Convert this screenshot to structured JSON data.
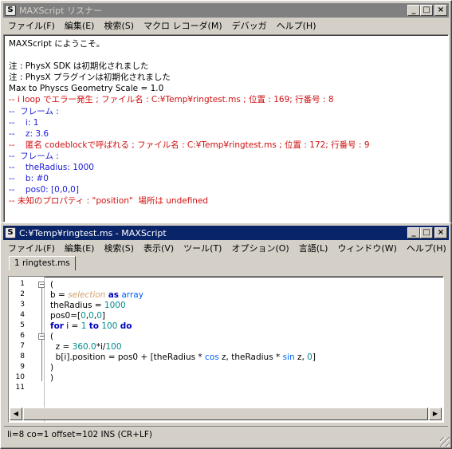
{
  "listener": {
    "title": "MAXScript リスナー",
    "icon": "maxscript-s-icon",
    "menu": [
      "ファイル(F)",
      "編集(E)",
      "検索(S)",
      "マクロ レコーダ(M)",
      "デバッガ",
      "ヘルプ(H)"
    ],
    "lines": [
      {
        "text": "MAXScript にようこそ。",
        "color": "black"
      },
      {
        "text": "",
        "color": "black"
      },
      {
        "text": "注 : PhysX SDK は初期化されました",
        "color": "black"
      },
      {
        "text": "注 : PhysX プラグインは初期化されました",
        "color": "black"
      },
      {
        "text": "Max to Physcs Geometry Scale = 1.0",
        "color": "black"
      },
      {
        "text": "-- i loop でエラー発生 ; ファイル名 : C:¥Temp¥ringtest.ms ; 位置 : 169; 行番号 : 8",
        "color": "red"
      },
      {
        "text": "--  フレーム :",
        "color": "blue"
      },
      {
        "text": "--    i: 1",
        "color": "blue"
      },
      {
        "text": "--    z: 3.6",
        "color": "blue"
      },
      {
        "text": "--    匿名 codeblockで呼ばれる ; ファイル名 : C:¥Temp¥ringtest.ms ; 位置 : 172; 行番号 : 9",
        "color": "red"
      },
      {
        "text": "--  フレーム :",
        "color": "blue"
      },
      {
        "text": "--    theRadius: 1000",
        "color": "blue"
      },
      {
        "text": "--    b: #0",
        "color": "blue"
      },
      {
        "text": "--    pos0: [0,0,0]",
        "color": "blue"
      },
      {
        "text": "-- 未知のプロパティ : \"position\"  場所は undefined",
        "color": "red"
      }
    ]
  },
  "editor": {
    "title": "C:¥Temp¥ringtest.ms - MAXScript",
    "icon": "maxscript-s-icon",
    "menu": [
      "ファイル(F)",
      "編集(E)",
      "検索(S)",
      "表示(V)",
      "ツール(T)",
      "オプション(O)",
      "言語(L)",
      "ウィンドウ(W)",
      "ヘルプ(H)"
    ],
    "tab_label": "1 ringtest.ms",
    "line_numbers": [
      "1",
      "2",
      "3",
      "4",
      "5",
      "6",
      "7",
      "8",
      "9",
      "10",
      "11"
    ],
    "code": [
      "(",
      "b = selection as array",
      "theRadius = 1000",
      "pos0=[0,0,0]",
      "for i = 1 to 100 do",
      "(",
      "  z = 360.0*i/100",
      "  b[i].position = pos0 + [theRadius * cos z, theRadius * sin z, 0]",
      ")",
      ")",
      ""
    ],
    "status": "li=8 co=1 offset=102 INS (CR+LF)"
  },
  "caption_buttons": {
    "minimize": "_",
    "maximize": "□",
    "close": "×"
  },
  "colors": {
    "active_title": "#0a246a",
    "inactive_title": "#808080",
    "keyword": "#0000c0",
    "number": "#008b8b",
    "variable": "#d2a06a",
    "error_text": "#d01010",
    "info_text": "#1a1ad8"
  }
}
